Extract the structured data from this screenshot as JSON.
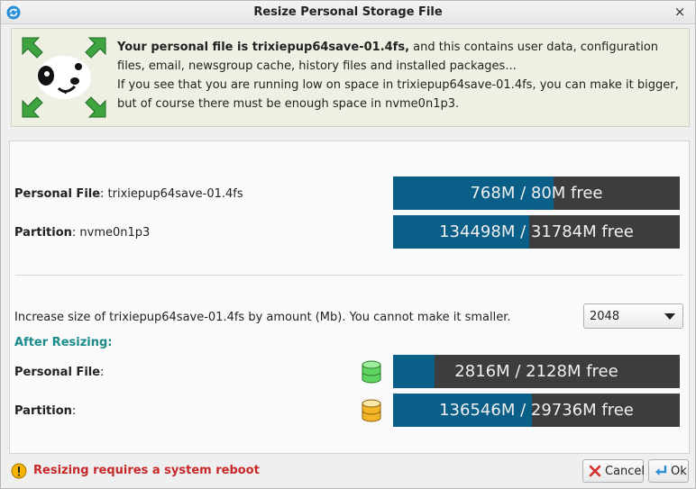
{
  "window": {
    "title": "Resize Personal Storage File",
    "close_symbol": "×"
  },
  "info": {
    "line1_bold": "Your personal file is trixiepup64save-01.4fs,",
    "line1_rest": " and this contains user data, configuration files, email, newsgroup cache, history files and installed packages...",
    "line2": "If you see that you are running low on space in trixiepup64save-01.4fs, you can make it bigger, but of course there must be enough space in nvme0n1p3."
  },
  "current": {
    "personal_label": "Personal File",
    "personal_value": ": trixiepup64save-01.4fs",
    "personal_bar_text": "768M / 80M free",
    "personal_bar_used_fraction": 0.56,
    "partition_label": "Partition",
    "partition_value": ": nvme0n1p3",
    "partition_bar_text": "134498M / 31784M free",
    "partition_bar_used_fraction": 0.475
  },
  "resize": {
    "prompt": "Increase size of trixiepup64save-01.4fs by amount (Mb). You cannot make it smaller.",
    "selected_amount": "2048"
  },
  "after": {
    "heading": "After Resizing:",
    "personal_label": "Personal File",
    "personal_colon": ":",
    "personal_bar_text": "2816M / 2128M free",
    "personal_bar_used_fraction": 0.145,
    "partition_label": "Partition",
    "partition_colon": ":",
    "partition_bar_text": "136546M / 29736M free",
    "partition_bar_used_fraction": 0.485
  },
  "status": {
    "message": "Resizing requires a system reboot"
  },
  "buttons": {
    "cancel": "Cancel",
    "ok": "Ok"
  },
  "colors": {
    "bar_fill": "#0a5f88",
    "bar_bg": "#3d3d3d",
    "after_heading": "#1a8a8a",
    "warning_text": "#c62828"
  },
  "icons": {
    "app": "refresh-icon",
    "mascot": "puppy-resize-icon",
    "personal_drum": "green-storage-drum-icon",
    "partition_drum": "yellow-storage-drum-icon",
    "warning": "warning-icon",
    "cancel": "cancel-x-icon",
    "ok": "enter-arrow-icon"
  }
}
